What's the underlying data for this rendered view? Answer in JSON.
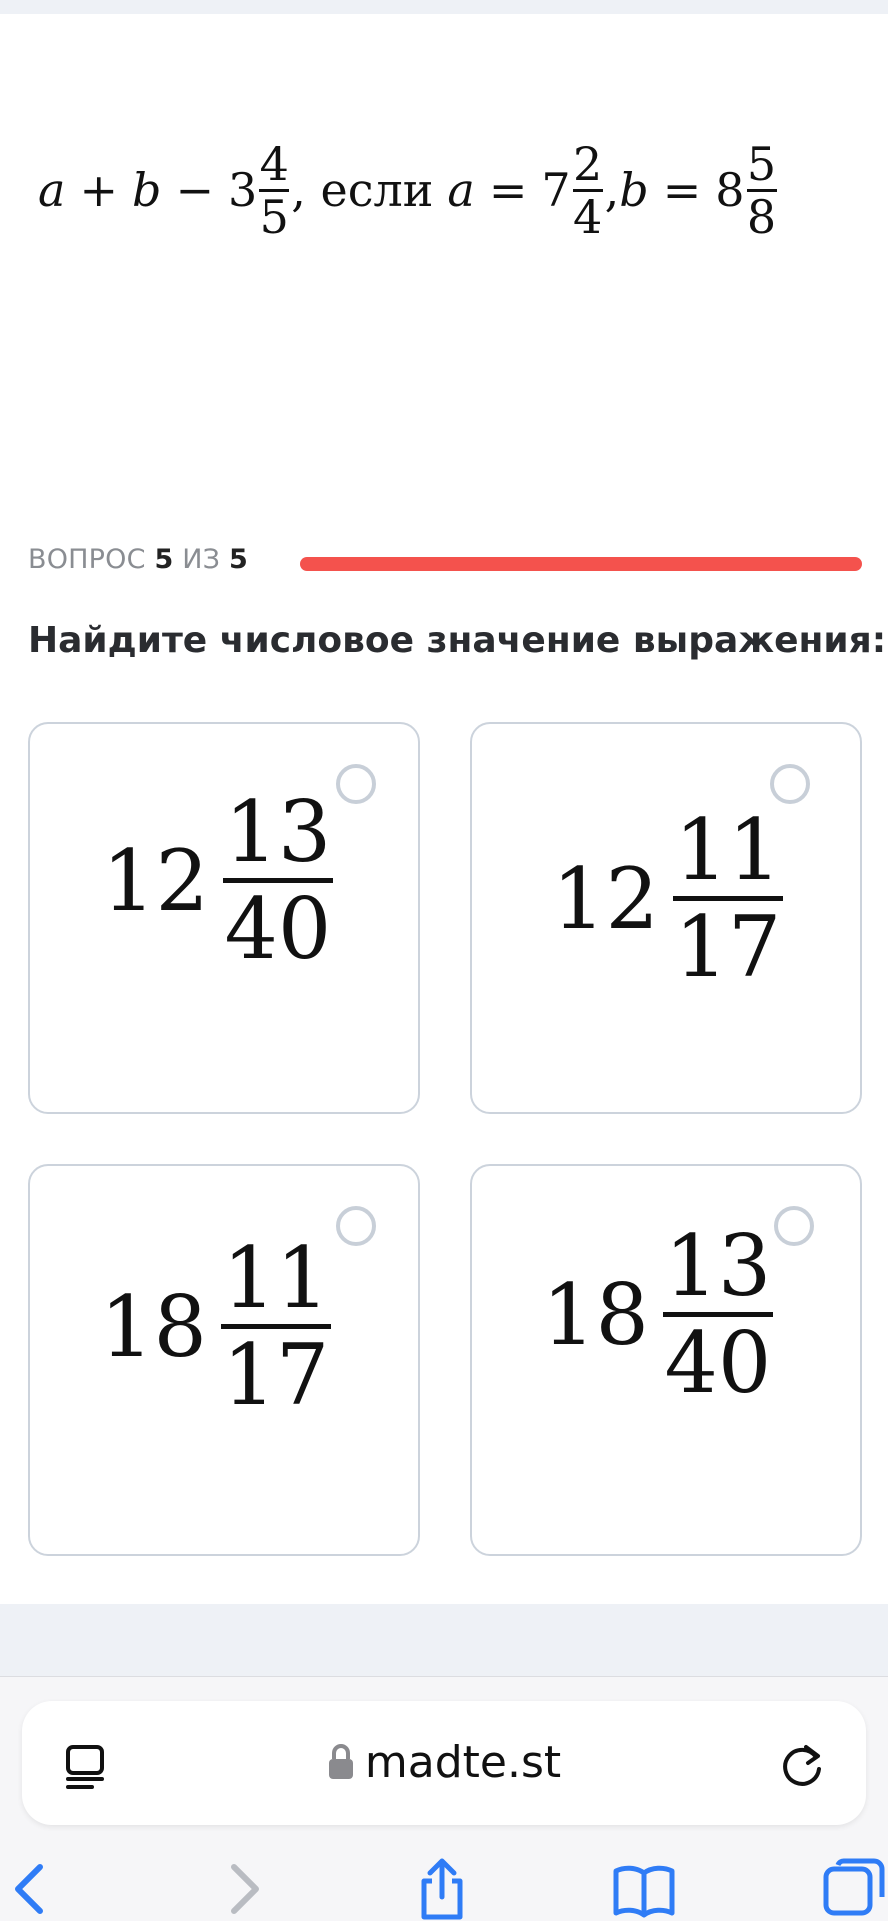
{
  "expression": {
    "a_var": "a",
    "plus": "+",
    "b_var": "b",
    "minus": "−",
    "whole1": "3",
    "num1": "4",
    "den1": "5",
    "if_text": ", если",
    "eq": "=",
    "whole2": "7",
    "num2": "2",
    "den2": "4",
    "comma": ",",
    "whole3": "8",
    "num3": "5",
    "den3": "8"
  },
  "progress": {
    "label_prefix": "ВОПРОС",
    "current": "5",
    "sep": "ИЗ",
    "total": "5",
    "fraction_complete": 1.0,
    "bar_color": "#f4524d"
  },
  "question": "Найдите числовое значение выражения:",
  "options": [
    {
      "whole": "12",
      "num": "13",
      "den": "40"
    },
    {
      "whole": "12",
      "num": "11",
      "den": "17"
    },
    {
      "whole": "18",
      "num": "11",
      "den": "17"
    },
    {
      "whole": "18",
      "num": "13",
      "den": "40"
    }
  ],
  "browser": {
    "url": "madte.st",
    "icons": [
      "reader-icon",
      "lock-icon",
      "reload-icon",
      "back-icon",
      "forward-icon",
      "share-icon",
      "bookmarks-icon",
      "tabs-icon"
    ]
  }
}
